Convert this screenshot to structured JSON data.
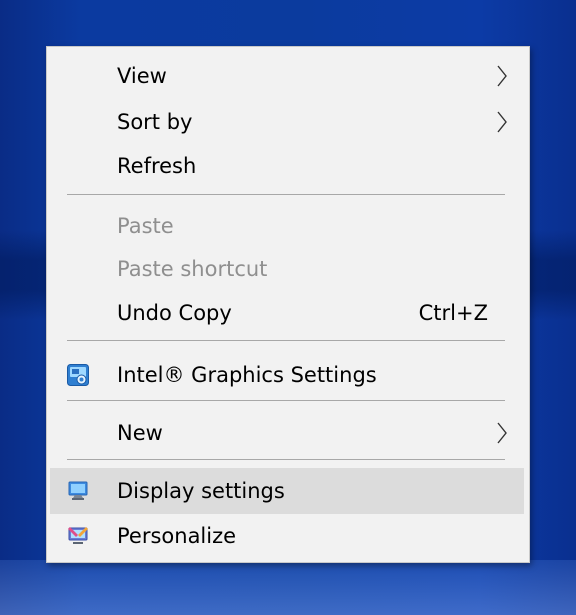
{
  "context_menu": {
    "items": [
      {
        "label": "View",
        "has_submenu": true
      },
      {
        "label": "Sort by",
        "has_submenu": true
      },
      {
        "label": "Refresh"
      },
      {
        "label": "Paste",
        "disabled": true
      },
      {
        "label": "Paste shortcut",
        "disabled": true
      },
      {
        "label": "Undo Copy",
        "shortcut": "Ctrl+Z"
      },
      {
        "label": "Intel® Graphics Settings",
        "icon": "intel-graphics-icon"
      },
      {
        "label": "New",
        "has_submenu": true
      },
      {
        "label": "Display settings",
        "icon": "display-icon",
        "highlighted": true
      },
      {
        "label": "Personalize",
        "icon": "personalize-icon"
      }
    ]
  },
  "colors": {
    "menu_background": "#f2f2f2",
    "highlight": "#dcdcdc",
    "disabled_text": "#8f8f8f",
    "separator": "#a8a8a8"
  }
}
